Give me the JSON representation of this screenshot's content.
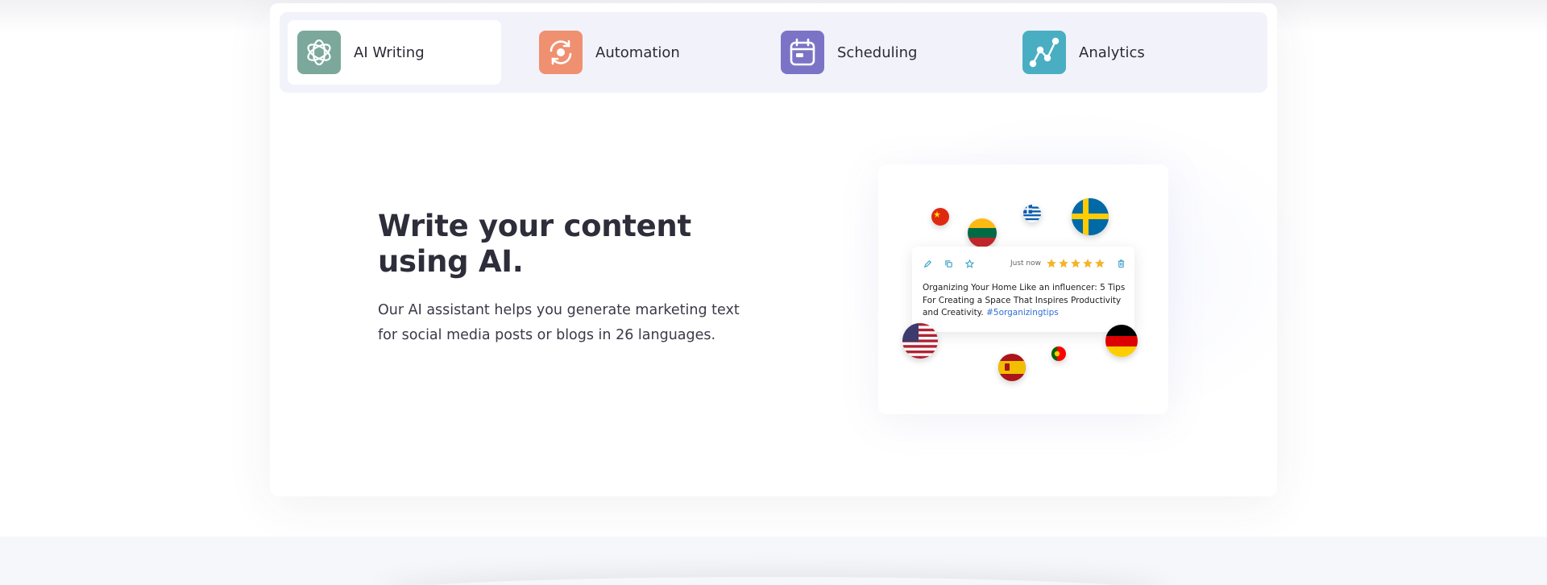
{
  "tabs": [
    {
      "label": "AI Writing",
      "icon": "openai-logo-icon",
      "color": "#7ba89a",
      "active": true
    },
    {
      "label": "Automation",
      "icon": "refresh-cycle-icon",
      "color": "#ef9070",
      "active": false
    },
    {
      "label": "Scheduling",
      "icon": "calendar-icon",
      "color": "#7b74c6",
      "active": false
    },
    {
      "label": "Analytics",
      "icon": "line-graph-icon",
      "color": "#4aaec3",
      "active": false
    }
  ],
  "hero": {
    "title": "Write your content using AI.",
    "description": "Our AI assistant helps you generate marketing text for social media posts or blogs in 26 languages."
  },
  "post_card": {
    "time": "Just now",
    "rating": 5,
    "text": "Organizing Your Home Like an influencer: 5 Tips For Creating a Space That Inspires Productivity and Creativity.",
    "hashtag": "#5organizingtips",
    "icons": [
      "edit-icon",
      "copy-icon",
      "star-outline-icon",
      "trash-icon"
    ]
  },
  "flags": [
    "china-flag",
    "lithuania-flag",
    "greece-flag",
    "sweden-flag",
    "usa-flag",
    "spain-flag",
    "portugal-flag",
    "germany-flag"
  ],
  "colors": {
    "star": "#f4b428",
    "accent_icon": "#3fa2c8",
    "hashtag": "#2f6fd6"
  }
}
